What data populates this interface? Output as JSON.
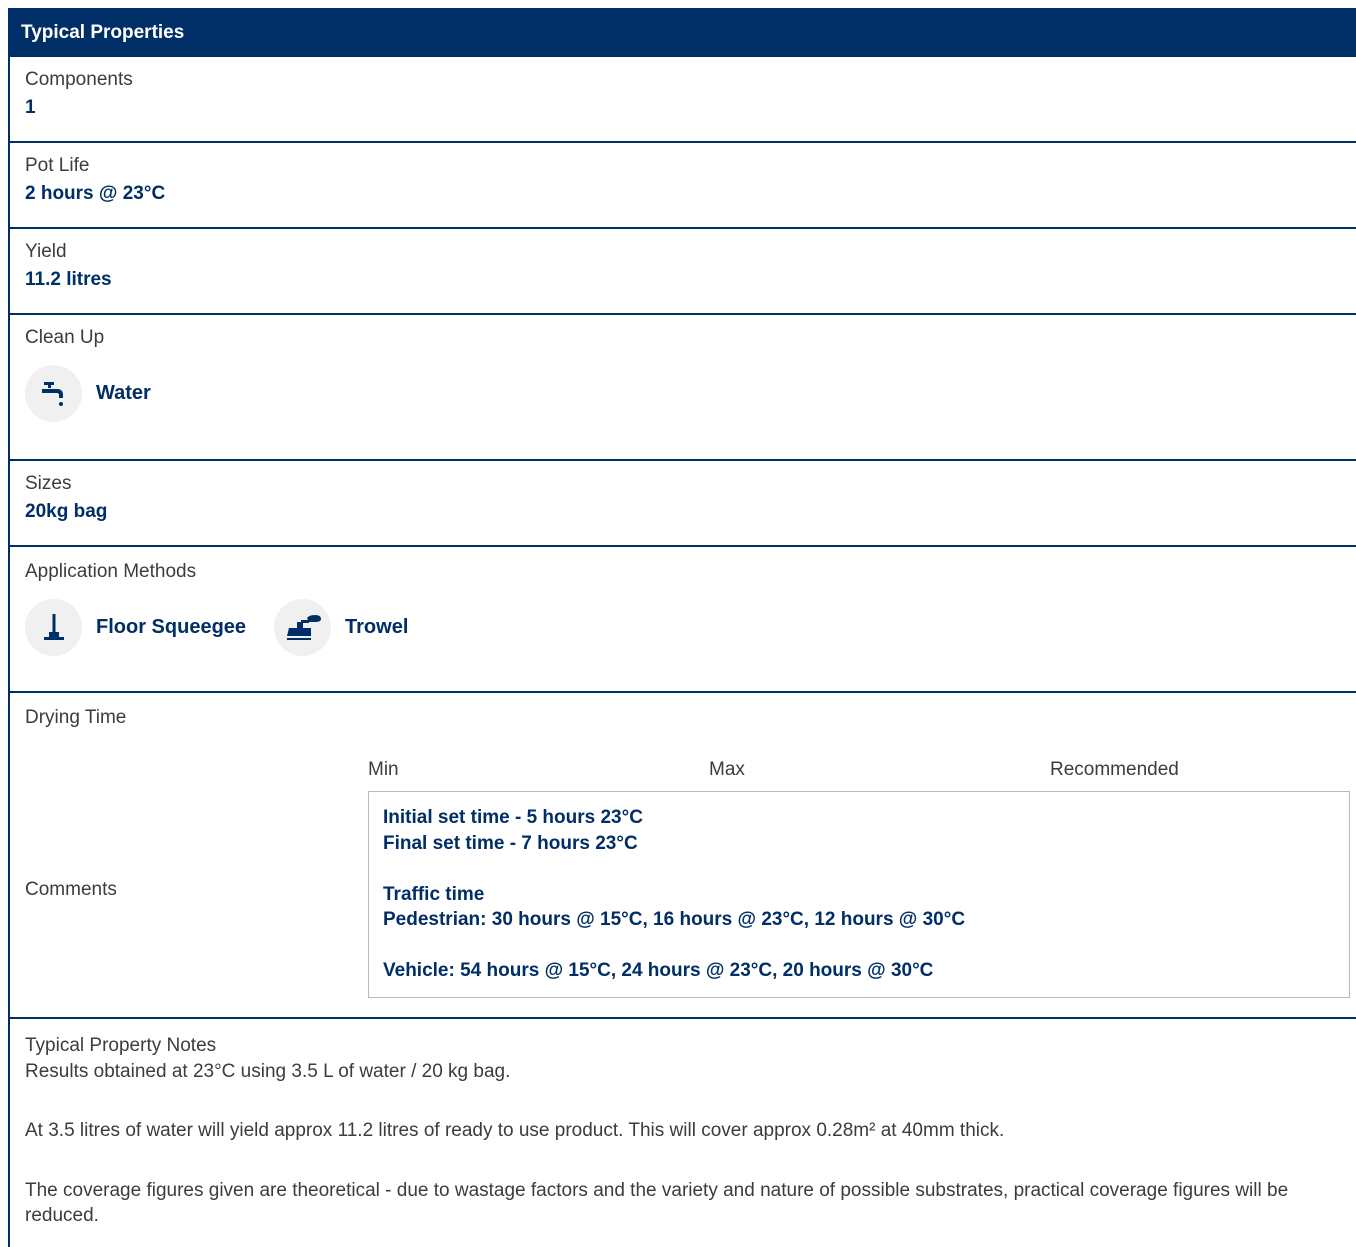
{
  "header": {
    "title": "Typical Properties"
  },
  "components": {
    "label": "Components",
    "value": "1"
  },
  "pot_life": {
    "label": "Pot Life",
    "value": "2 hours @ 23°C"
  },
  "yield": {
    "label": "Yield",
    "value": "11.2 litres"
  },
  "clean_up": {
    "label": "Clean Up",
    "items": [
      {
        "icon": "water-tap-icon",
        "label": "Water"
      }
    ]
  },
  "sizes": {
    "label": "Sizes",
    "value": "20kg bag"
  },
  "application_methods": {
    "label": "Application Methods",
    "items": [
      {
        "icon": "floor-squeegee-icon",
        "label": "Floor Squeegee"
      },
      {
        "icon": "trowel-icon",
        "label": "Trowel"
      }
    ]
  },
  "drying_time": {
    "label": "Drying Time",
    "columns": {
      "min": "Min",
      "max": "Max",
      "recommended": "Recommended"
    },
    "comments_label": "Comments",
    "comments": {
      "line1": "Initial set time - 5 hours 23°C",
      "line2": "Final set time - 7 hours 23°C",
      "line3": "Traffic time",
      "line4": "Pedestrian: 30 hours @ 15°C, 16 hours @ 23°C, 12 hours @ 30°C",
      "line5": "Vehicle: 54 hours @ 15°C, 24 hours @ 23°C, 20 hours @ 30°C"
    }
  },
  "notes": {
    "label": "Typical Property Notes",
    "p1": "Results obtained at 23°C using 3.5 L of water / 20 kg bag.",
    "p2": "At 3.5 litres of water will yield approx 11.2 litres of ready to use product. This will cover approx 0.28m² at 40mm thick.",
    "p3": "The coverage figures given are theoretical - due to wastage factors and the variety and nature of possible substrates, practical coverage figures will be reduced."
  },
  "colors": {
    "brand": "#002e66",
    "icon_bg": "#f0f0f0",
    "border": "#b9b9b9"
  }
}
